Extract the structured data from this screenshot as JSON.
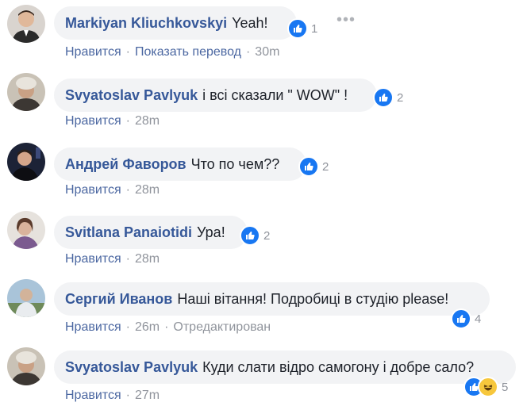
{
  "comments": [
    {
      "author": "Markiyan Kliuchkovskyi",
      "text": "Yeah!",
      "reactions": {
        "count": "1",
        "haha": false
      },
      "actions": {
        "like": "Нравится",
        "translate": "Показать перевод",
        "time": "30m"
      }
    },
    {
      "author": "Svyatoslav Pavlyuk",
      "text": "і всі сказали \" WOW\" !",
      "reactions": {
        "count": "2",
        "haha": false
      },
      "actions": {
        "like": "Нравится",
        "time": "28m"
      }
    },
    {
      "author": "Андрей Фаворов",
      "text": "Что по чем??",
      "reactions": {
        "count": "2",
        "haha": false
      },
      "actions": {
        "like": "Нравится",
        "time": "28m"
      }
    },
    {
      "author": "Svitlana Panaiotidi",
      "text": "Ура!",
      "reactions": {
        "count": "2",
        "haha": false
      },
      "actions": {
        "like": "Нравится",
        "time": "28m"
      }
    },
    {
      "author": "Сергий Иванов",
      "text": "Наші вітання! Подробиці в студію please!",
      "reactions": {
        "count": "4",
        "haha": false
      },
      "actions": {
        "like": "Нравится",
        "time": "26m",
        "edited": "Отредактирован"
      }
    },
    {
      "author": "Svyatoslav Pavlyuk",
      "text": "Куди слати відро самогону і добре сало?",
      "reactions": {
        "count": "5",
        "haha": true
      },
      "actions": {
        "like": "Нравится",
        "time": "27m"
      }
    }
  ],
  "more_icon": "more-horizontal-icon",
  "colors": {
    "link": "#365899",
    "bubble": "#f2f3f5",
    "like": "#1877f2",
    "meta": "#90949c"
  }
}
